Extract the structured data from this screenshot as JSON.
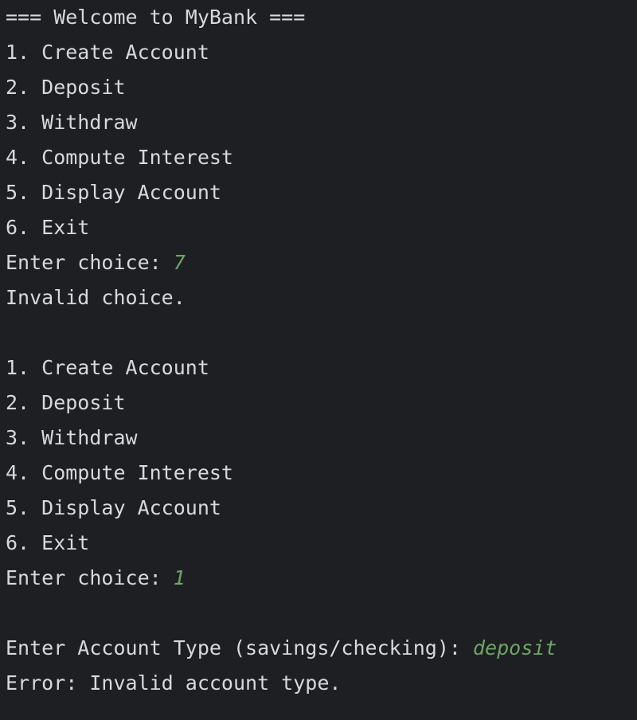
{
  "console": {
    "welcome": "=== Welcome to MyBank ===",
    "menu1": [
      "1. Create Account",
      "2. Deposit",
      "3. Withdraw",
      "4. Compute Interest",
      "5. Display Account",
      "6. Exit"
    ],
    "prompt1": "Enter choice: ",
    "input1": "7",
    "msg1": "Invalid choice.",
    "menu2": [
      "1. Create Account",
      "2. Deposit",
      "3. Withdraw",
      "4. Compute Interest",
      "5. Display Account",
      "6. Exit"
    ],
    "prompt2": "Enter choice: ",
    "input2": "1",
    "prompt3": "Enter Account Type (savings/checking): ",
    "input3": "deposit",
    "error": "Error: Invalid account type."
  },
  "colors": {
    "background": "#1e1f22",
    "text": "#d7d9dc",
    "user_input": "#6fa567"
  }
}
